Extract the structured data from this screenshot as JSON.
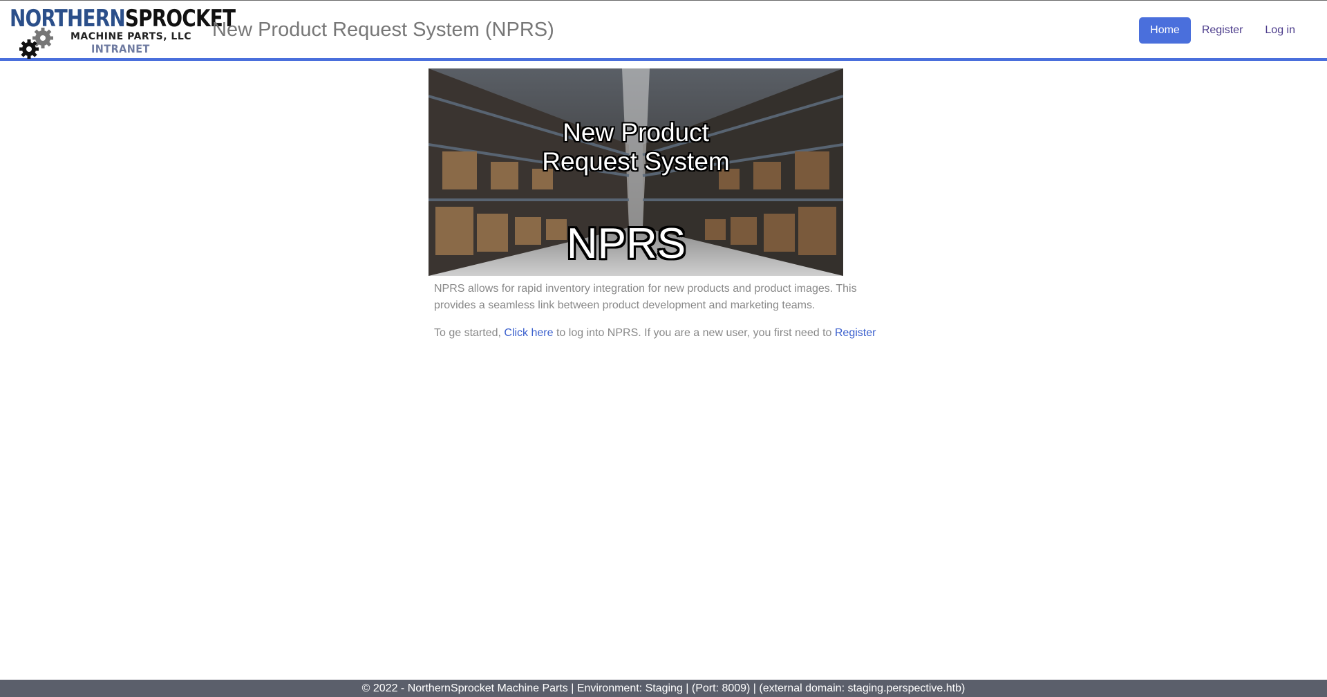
{
  "logo": {
    "name_part1": "NORTHERN",
    "name_part2": "SPROCKET",
    "subtitle": "MACHINE PARTS, LLC",
    "tag": "INTRANET",
    "icon": "gear-icon"
  },
  "header": {
    "title": "New Product Request System (NPRS)"
  },
  "nav": {
    "home": "Home",
    "register": "Register",
    "login": "Log in"
  },
  "banner": {
    "title_line1": "New Product",
    "title_line2": "Request System",
    "abbr": "NPRS"
  },
  "content": {
    "intro": "NPRS allows for rapid inventory integration for new products and product images. This provides a seamless link between product development and marketing teams.",
    "start_prefix": "To ge started, ",
    "click_here": "Click here",
    "start_middle": " to log into NPRS. If you are a new user, you first need to ",
    "register_link": "Register"
  },
  "footer": {
    "text": "© 2022 - NorthernSprocket Machine Parts | Environment: Staging | (Port: 8009) | (external domain: staging.perspective.htb)"
  },
  "colors": {
    "accent": "#4a6fdc",
    "footer_bg": "#5b5f6b",
    "link": "#3a5fcd"
  }
}
